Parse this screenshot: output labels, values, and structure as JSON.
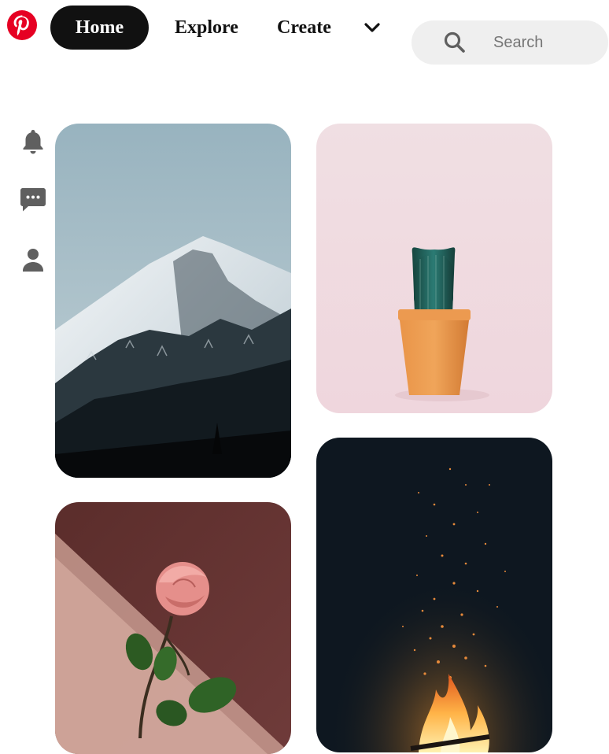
{
  "header": {
    "logo_icon": "pinterest-logo-icon",
    "brand_color": "#e60023",
    "nav": {
      "home": "Home",
      "explore": "Explore",
      "create": "Create",
      "more_icon": "chevron-down-icon"
    },
    "search": {
      "placeholder": "Search",
      "icon": "search-icon"
    }
  },
  "sidebar": {
    "items": [
      {
        "icon": "bell-icon"
      },
      {
        "icon": "chat-icon"
      },
      {
        "icon": "person-icon"
      }
    ],
    "icon_color": "#5f5f5f"
  },
  "feed": {
    "pins": [
      {
        "subject": "snowy-mountain"
      },
      {
        "subject": "cactus-in-pot"
      },
      {
        "subject": "pink-rose"
      },
      {
        "subject": "campfire-sparks"
      }
    ]
  }
}
